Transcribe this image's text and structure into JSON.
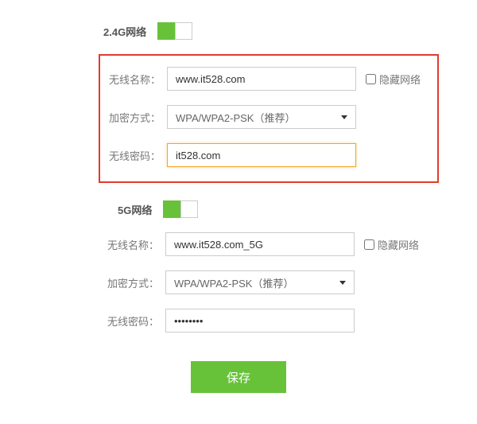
{
  "band24": {
    "title": "2.4G网络",
    "toggle_on": true,
    "ssid_label": "无线名称：",
    "ssid_value": "www.it528.com",
    "hide_label": "隐藏网络",
    "hide_checked": false,
    "enc_label": "加密方式：",
    "enc_value": "WPA/WPA2-PSK（推荐）",
    "pwd_label": "无线密码：",
    "pwd_value": "it528.com",
    "pwd_focused": true
  },
  "band5": {
    "title": "5G网络",
    "toggle_on": true,
    "ssid_label": "无线名称：",
    "ssid_value": "www.it528.com_5G",
    "hide_label": "隐藏网络",
    "hide_checked": false,
    "enc_label": "加密方式：",
    "enc_value": "WPA/WPA2-PSK（推荐）",
    "pwd_label": "无线密码：",
    "pwd_value": "••••••••"
  },
  "save_label": "保存"
}
